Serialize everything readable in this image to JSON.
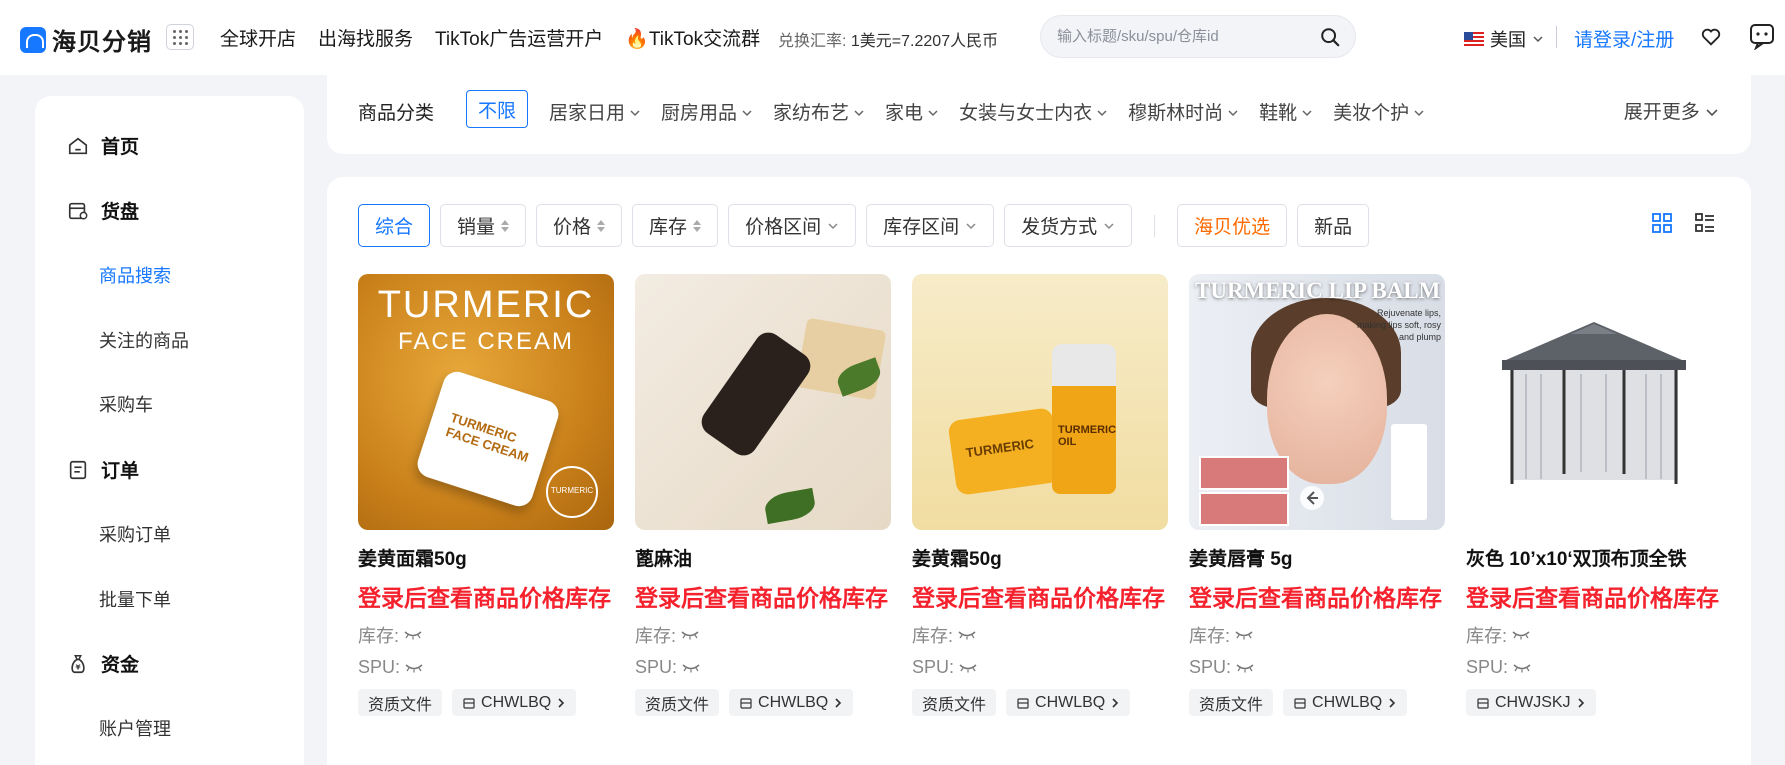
{
  "brand": {
    "name": "海贝分销"
  },
  "nav": [
    "全球开店",
    "出海找服务",
    "TikTok广告运营开户",
    "TikTok交流群"
  ],
  "rate": {
    "label": "兑换汇率:",
    "value": "1美元=7.2207人民币"
  },
  "search": {
    "placeholder": "输入标题/sku/spu/仓库id"
  },
  "country": "美国",
  "login": "请登录/注册",
  "sidebar": [
    {
      "label": "首页",
      "type": "major",
      "icon": "home-icon"
    },
    {
      "label": "货盘",
      "type": "major",
      "icon": "goods-icon"
    },
    {
      "label": "商品搜索",
      "type": "sub",
      "active": true
    },
    {
      "label": "关注的商品",
      "type": "sub"
    },
    {
      "label": "采购车",
      "type": "sub"
    },
    {
      "label": "订单",
      "type": "major",
      "icon": "order-icon"
    },
    {
      "label": "采购订单",
      "type": "sub"
    },
    {
      "label": "批量下单",
      "type": "sub"
    },
    {
      "label": "资金",
      "type": "major",
      "icon": "money-bag-icon"
    },
    {
      "label": "账户管理",
      "type": "sub"
    }
  ],
  "categories": {
    "label": "商品分类",
    "all": "不限",
    "items": [
      "居家日用",
      "厨房用品",
      "家纺布艺",
      "家电",
      "女装与女士内衣",
      "穆斯林时尚",
      "鞋靴",
      "美妆个护"
    ],
    "more": "展开更多"
  },
  "filters": {
    "comprehensive": "综合",
    "sales": "销量",
    "price": "价格",
    "stock": "库存",
    "price_range": "价格区间",
    "stock_range": "库存区间",
    "shipping": "发货方式",
    "featured": "海贝优选",
    "new": "新品"
  },
  "product_labels": {
    "price": "登录后查看商品价格库存",
    "stock": "库存:",
    "spu": "SPU:",
    "qualification": "资质文件"
  },
  "products": [
    {
      "title": "姜黄面霜50g",
      "image": "turmeric-face-cream",
      "image_text": [
        "TURMERIC",
        "FACE CREAM",
        "TURMERIC FACE CREAM",
        "TURMERIC"
      ],
      "has_qualification": true,
      "supplier": "CHWLBQ"
    },
    {
      "title": "蓖麻油",
      "image": "castor-oil-bottle",
      "has_qualification": true,
      "supplier": "CHWLBQ"
    },
    {
      "title": "姜黄霜50g",
      "image": "turmeric-cream-oil",
      "image_text": [
        "TURMERIC",
        "TURMERIC OIL"
      ],
      "has_qualification": true,
      "supplier": "CHWLBQ"
    },
    {
      "title": "姜黄唇膏 5g",
      "image": "turmeric-lip-balm",
      "image_text": [
        "TURMERIC LIP BALM",
        "Rejuvenate lips, making lips soft, rosy and plump"
      ],
      "has_qualification": true,
      "supplier": "CHWLBQ"
    },
    {
      "title": "灰色 10’x10‘双顶布顶全铁",
      "image": "gazebo",
      "has_qualification": false,
      "supplier": "CHWJSKJ"
    }
  ],
  "colors": {
    "accent": "#1677ff",
    "price": "#f5222d",
    "featured": "#ff6a00"
  }
}
